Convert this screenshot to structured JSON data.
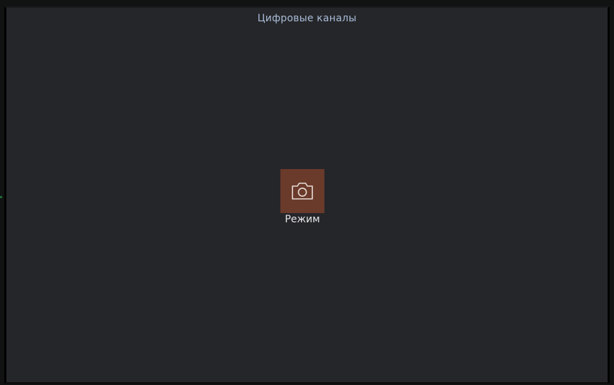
{
  "panel": {
    "title": "Цифровые каналы"
  },
  "mode_button": {
    "icon": "camera-icon",
    "label": "Режим",
    "bg_color": "#6a3a2b"
  }
}
